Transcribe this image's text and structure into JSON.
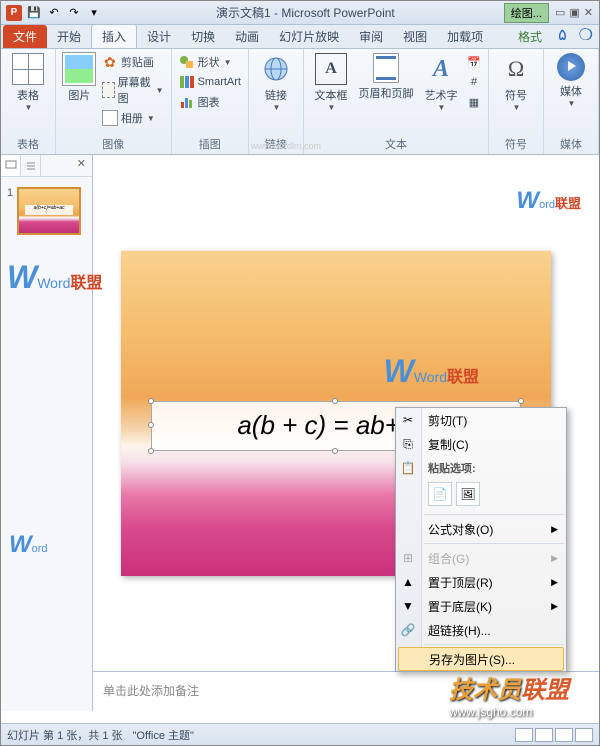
{
  "title": "演示文稿1 - Microsoft PowerPoint",
  "drawing_tools": "绘图...",
  "tabs": {
    "file": "文件",
    "home": "开始",
    "insert": "插入",
    "design": "设计",
    "transitions": "切换",
    "animations": "动画",
    "slideshow": "幻灯片放映",
    "review": "审阅",
    "view": "视图",
    "addins": "加载项",
    "format": "格式"
  },
  "ribbon": {
    "tables": {
      "table": "表格",
      "group": "表格"
    },
    "images": {
      "picture": "图片",
      "clipart": "剪贴画",
      "screenshot": "屏幕截图",
      "album": "相册",
      "group": "图像"
    },
    "illustrations": {
      "shapes": "形状",
      "smartart": "SmartArt",
      "chart": "图表",
      "group": "插图"
    },
    "links": {
      "hyperlink": "链接",
      "group": "链接"
    },
    "text": {
      "textbox": "文本框",
      "headerfooter": "页眉和页脚",
      "wordart": "艺术字",
      "group": "文本"
    },
    "symbols": {
      "symbol": "符号",
      "group": "符号"
    },
    "media": {
      "media": "媒体",
      "group": "媒体"
    }
  },
  "thumb": {
    "num": "1"
  },
  "equation": "a(b + c) = ab+ ac",
  "notes_placeholder": "单击此处添加备注",
  "context_menu": {
    "cut": "剪切(T)",
    "copy": "复制(C)",
    "paste_options": "粘贴选项:",
    "formula_object": "公式对象(O)",
    "group": "组合(G)",
    "bring_front": "置于顶层(R)",
    "send_back": "置于底层(K)",
    "hyperlink": "超链接(H)...",
    "save_as_picture": "另存为图片(S)..."
  },
  "watermark": {
    "word": "Word",
    "lm": "联盟",
    "url": "www.wordlm.com"
  },
  "bottom_brand": {
    "tech": "技术员",
    "lm": "联盟",
    "url": "www.jsgho.com"
  },
  "status": {
    "slide": "幻灯片 第 1 张，共 1 张",
    "theme": "\"Office 主题\""
  }
}
